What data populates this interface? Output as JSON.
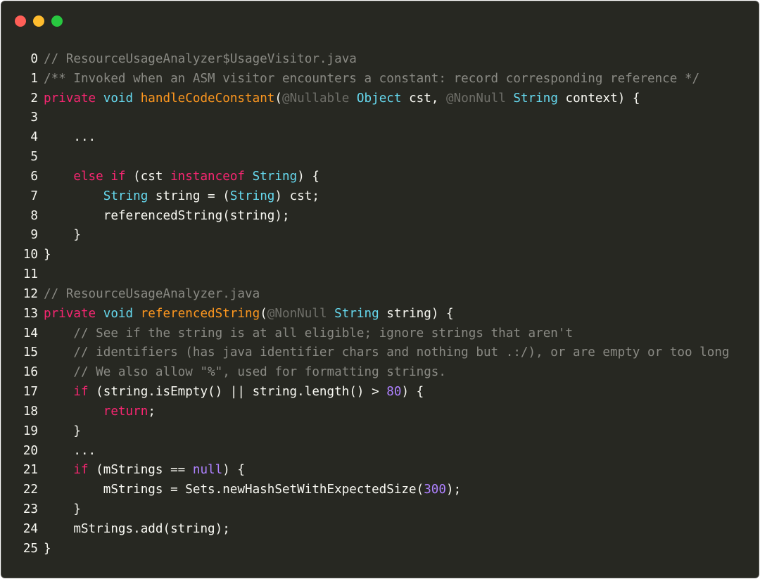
{
  "window": {
    "buttons": [
      {
        "name": "close-button",
        "color": "#ff5f57"
      },
      {
        "name": "minimize-button",
        "color": "#febc2e"
      },
      {
        "name": "zoom-button",
        "color": "#28c840"
      }
    ]
  },
  "colors": {
    "background": "#272822",
    "plain": "#f8f8f2",
    "comment": "#8a8a84",
    "keyword": "#f92672",
    "type": "#66d9ef",
    "function": "#fd971f",
    "annotation": "#6e6e68",
    "number": "#ae81ff"
  },
  "code": {
    "language": "java",
    "lines": [
      {
        "n": "0",
        "tokens": [
          [
            "comment",
            "// ResourceUsageAnalyzer$UsageVisitor.java"
          ]
        ]
      },
      {
        "n": "1",
        "tokens": [
          [
            "comment",
            "/** Invoked when an ASM visitor encounters a constant: record corresponding reference */"
          ]
        ]
      },
      {
        "n": "2",
        "tokens": [
          [
            "keyword",
            "private"
          ],
          [
            "plain",
            " "
          ],
          [
            "type",
            "void"
          ],
          [
            "plain",
            " "
          ],
          [
            "func",
            "handleCodeConstant"
          ],
          [
            "plain",
            "("
          ],
          [
            "annot",
            "@Nullable"
          ],
          [
            "plain",
            " "
          ],
          [
            "type",
            "Object"
          ],
          [
            "plain",
            " cst, "
          ],
          [
            "annot",
            "@NonNull"
          ],
          [
            "plain",
            " "
          ],
          [
            "type",
            "String"
          ],
          [
            "plain",
            " context) {"
          ]
        ]
      },
      {
        "n": "3",
        "tokens": []
      },
      {
        "n": "4",
        "tokens": [
          [
            "plain",
            "    ..."
          ]
        ]
      },
      {
        "n": "5",
        "tokens": []
      },
      {
        "n": "6",
        "tokens": [
          [
            "plain",
            "    "
          ],
          [
            "keyword",
            "else"
          ],
          [
            "plain",
            " "
          ],
          [
            "keyword",
            "if"
          ],
          [
            "plain",
            " (cst "
          ],
          [
            "keyword",
            "instanceof"
          ],
          [
            "plain",
            " "
          ],
          [
            "type",
            "String"
          ],
          [
            "plain",
            ") {"
          ]
        ]
      },
      {
        "n": "7",
        "tokens": [
          [
            "plain",
            "        "
          ],
          [
            "type",
            "String"
          ],
          [
            "plain",
            " string = ("
          ],
          [
            "type",
            "String"
          ],
          [
            "plain",
            ") cst;"
          ]
        ]
      },
      {
        "n": "8",
        "tokens": [
          [
            "plain",
            "        referencedString(string);"
          ]
        ]
      },
      {
        "n": "9",
        "tokens": [
          [
            "plain",
            "    }"
          ]
        ]
      },
      {
        "n": "10",
        "tokens": [
          [
            "plain",
            "}"
          ]
        ]
      },
      {
        "n": "11",
        "tokens": []
      },
      {
        "n": "12",
        "tokens": [
          [
            "comment",
            "// ResourceUsageAnalyzer.java"
          ]
        ]
      },
      {
        "n": "13",
        "tokens": [
          [
            "keyword",
            "private"
          ],
          [
            "plain",
            " "
          ],
          [
            "type",
            "void"
          ],
          [
            "plain",
            " "
          ],
          [
            "func",
            "referencedString"
          ],
          [
            "plain",
            "("
          ],
          [
            "annot",
            "@NonNull"
          ],
          [
            "plain",
            " "
          ],
          [
            "type",
            "String"
          ],
          [
            "plain",
            " string) {"
          ]
        ]
      },
      {
        "n": "14",
        "tokens": [
          [
            "plain",
            "    "
          ],
          [
            "comment",
            "// See if the string is at all eligible; ignore strings that aren't"
          ]
        ]
      },
      {
        "n": "15",
        "tokens": [
          [
            "plain",
            "    "
          ],
          [
            "comment",
            "// identifiers (has java identifier chars and nothing but .:/), or are empty or too long"
          ]
        ]
      },
      {
        "n": "16",
        "tokens": [
          [
            "plain",
            "    "
          ],
          [
            "comment",
            "// We also allow \"%\", used for formatting strings."
          ]
        ]
      },
      {
        "n": "17",
        "tokens": [
          [
            "plain",
            "    "
          ],
          [
            "keyword",
            "if"
          ],
          [
            "plain",
            " (string.isEmpty() || string.length() > "
          ],
          [
            "number",
            "80"
          ],
          [
            "plain",
            ") {"
          ]
        ]
      },
      {
        "n": "18",
        "tokens": [
          [
            "plain",
            "        "
          ],
          [
            "keyword",
            "return"
          ],
          [
            "plain",
            ";"
          ]
        ]
      },
      {
        "n": "19",
        "tokens": [
          [
            "plain",
            "    }"
          ]
        ]
      },
      {
        "n": "20",
        "tokens": [
          [
            "plain",
            "    ..."
          ]
        ]
      },
      {
        "n": "21",
        "tokens": [
          [
            "plain",
            "    "
          ],
          [
            "keyword",
            "if"
          ],
          [
            "plain",
            " (mStrings == "
          ],
          [
            "number",
            "null"
          ],
          [
            "plain",
            ") {"
          ]
        ]
      },
      {
        "n": "22",
        "tokens": [
          [
            "plain",
            "        mStrings = Sets.newHashSetWithExpectedSize("
          ],
          [
            "number",
            "300"
          ],
          [
            "plain",
            ");"
          ]
        ]
      },
      {
        "n": "23",
        "tokens": [
          [
            "plain",
            "    }"
          ]
        ]
      },
      {
        "n": "24",
        "tokens": [
          [
            "plain",
            "    mStrings.add(string);"
          ]
        ]
      },
      {
        "n": "25",
        "tokens": [
          [
            "plain",
            "}"
          ]
        ]
      }
    ]
  }
}
